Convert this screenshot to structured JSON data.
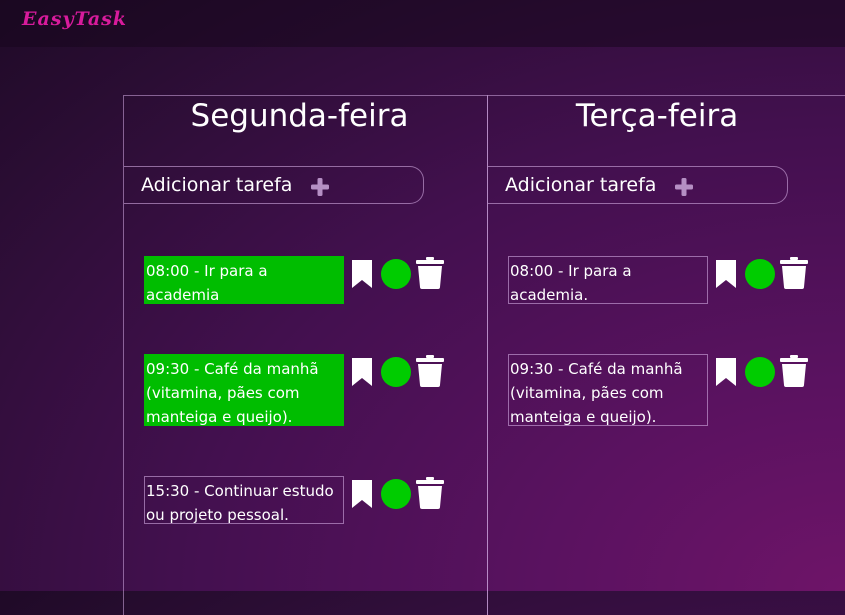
{
  "app": {
    "brand": "EasyTask"
  },
  "colors": {
    "accent": "#d81b9c",
    "done_green": "#00bd00",
    "check_green": "#00cc00"
  },
  "days": [
    {
      "title": "Segunda-feira",
      "add_label": "Adicionar tarefa",
      "tasks": [
        {
          "text": "08:00 - Ir para a academia",
          "done": true
        },
        {
          "text": "09:30 - Café da manhã (vitamina, pães com manteiga e queijo).",
          "done": true
        },
        {
          "text": "15:30 - Continuar estudo ou projeto pessoal.",
          "done": false
        }
      ]
    },
    {
      "title": "Terça-feira",
      "add_label": "Adicionar tarefa",
      "tasks": [
        {
          "text": "08:00 - Ir para a academia.",
          "done": false
        },
        {
          "text": "09:30 - Café da manhã (vitamina, pães com manteiga e queijo).",
          "done": false
        }
      ]
    }
  ],
  "icons": {
    "add": "plus-icon",
    "bookmark": "bookmark-icon",
    "complete": "check-circle-icon",
    "delete": "trash-icon"
  }
}
